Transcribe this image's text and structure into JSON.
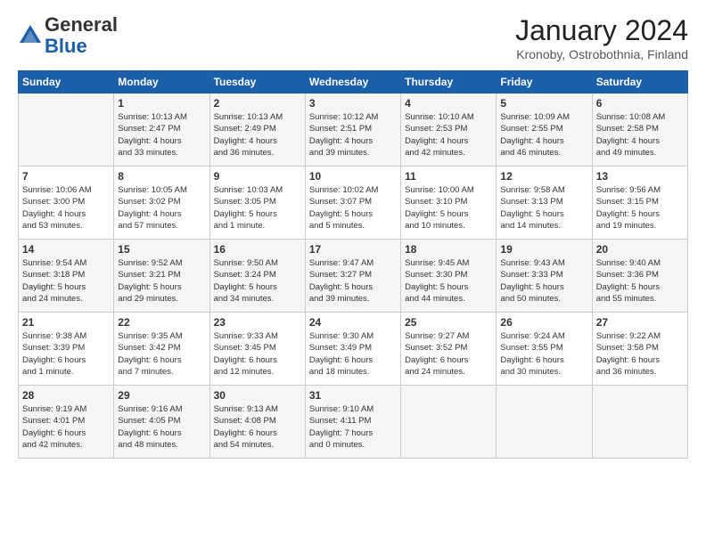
{
  "header": {
    "logo_general": "General",
    "logo_blue": "Blue",
    "month_title": "January 2024",
    "location": "Kronoby, Ostrobothnia, Finland"
  },
  "days_of_week": [
    "Sunday",
    "Monday",
    "Tuesday",
    "Wednesday",
    "Thursday",
    "Friday",
    "Saturday"
  ],
  "weeks": [
    [
      {
        "day": "",
        "info": ""
      },
      {
        "day": "1",
        "info": "Sunrise: 10:13 AM\nSunset: 2:47 PM\nDaylight: 4 hours\nand 33 minutes."
      },
      {
        "day": "2",
        "info": "Sunrise: 10:13 AM\nSunset: 2:49 PM\nDaylight: 4 hours\nand 36 minutes."
      },
      {
        "day": "3",
        "info": "Sunrise: 10:12 AM\nSunset: 2:51 PM\nDaylight: 4 hours\nand 39 minutes."
      },
      {
        "day": "4",
        "info": "Sunrise: 10:10 AM\nSunset: 2:53 PM\nDaylight: 4 hours\nand 42 minutes."
      },
      {
        "day": "5",
        "info": "Sunrise: 10:09 AM\nSunset: 2:55 PM\nDaylight: 4 hours\nand 46 minutes."
      },
      {
        "day": "6",
        "info": "Sunrise: 10:08 AM\nSunset: 2:58 PM\nDaylight: 4 hours\nand 49 minutes."
      }
    ],
    [
      {
        "day": "7",
        "info": "Sunrise: 10:06 AM\nSunset: 3:00 PM\nDaylight: 4 hours\nand 53 minutes."
      },
      {
        "day": "8",
        "info": "Sunrise: 10:05 AM\nSunset: 3:02 PM\nDaylight: 4 hours\nand 57 minutes."
      },
      {
        "day": "9",
        "info": "Sunrise: 10:03 AM\nSunset: 3:05 PM\nDaylight: 5 hours\nand 1 minute."
      },
      {
        "day": "10",
        "info": "Sunrise: 10:02 AM\nSunset: 3:07 PM\nDaylight: 5 hours\nand 5 minutes."
      },
      {
        "day": "11",
        "info": "Sunrise: 10:00 AM\nSunset: 3:10 PM\nDaylight: 5 hours\nand 10 minutes."
      },
      {
        "day": "12",
        "info": "Sunrise: 9:58 AM\nSunset: 3:13 PM\nDaylight: 5 hours\nand 14 minutes."
      },
      {
        "day": "13",
        "info": "Sunrise: 9:56 AM\nSunset: 3:15 PM\nDaylight: 5 hours\nand 19 minutes."
      }
    ],
    [
      {
        "day": "14",
        "info": "Sunrise: 9:54 AM\nSunset: 3:18 PM\nDaylight: 5 hours\nand 24 minutes."
      },
      {
        "day": "15",
        "info": "Sunrise: 9:52 AM\nSunset: 3:21 PM\nDaylight: 5 hours\nand 29 minutes."
      },
      {
        "day": "16",
        "info": "Sunrise: 9:50 AM\nSunset: 3:24 PM\nDaylight: 5 hours\nand 34 minutes."
      },
      {
        "day": "17",
        "info": "Sunrise: 9:47 AM\nSunset: 3:27 PM\nDaylight: 5 hours\nand 39 minutes."
      },
      {
        "day": "18",
        "info": "Sunrise: 9:45 AM\nSunset: 3:30 PM\nDaylight: 5 hours\nand 44 minutes."
      },
      {
        "day": "19",
        "info": "Sunrise: 9:43 AM\nSunset: 3:33 PM\nDaylight: 5 hours\nand 50 minutes."
      },
      {
        "day": "20",
        "info": "Sunrise: 9:40 AM\nSunset: 3:36 PM\nDaylight: 5 hours\nand 55 minutes."
      }
    ],
    [
      {
        "day": "21",
        "info": "Sunrise: 9:38 AM\nSunset: 3:39 PM\nDaylight: 6 hours\nand 1 minute."
      },
      {
        "day": "22",
        "info": "Sunrise: 9:35 AM\nSunset: 3:42 PM\nDaylight: 6 hours\nand 7 minutes."
      },
      {
        "day": "23",
        "info": "Sunrise: 9:33 AM\nSunset: 3:45 PM\nDaylight: 6 hours\nand 12 minutes."
      },
      {
        "day": "24",
        "info": "Sunrise: 9:30 AM\nSunset: 3:49 PM\nDaylight: 6 hours\nand 18 minutes."
      },
      {
        "day": "25",
        "info": "Sunrise: 9:27 AM\nSunset: 3:52 PM\nDaylight: 6 hours\nand 24 minutes."
      },
      {
        "day": "26",
        "info": "Sunrise: 9:24 AM\nSunset: 3:55 PM\nDaylight: 6 hours\nand 30 minutes."
      },
      {
        "day": "27",
        "info": "Sunrise: 9:22 AM\nSunset: 3:58 PM\nDaylight: 6 hours\nand 36 minutes."
      }
    ],
    [
      {
        "day": "28",
        "info": "Sunrise: 9:19 AM\nSunset: 4:01 PM\nDaylight: 6 hours\nand 42 minutes."
      },
      {
        "day": "29",
        "info": "Sunrise: 9:16 AM\nSunset: 4:05 PM\nDaylight: 6 hours\nand 48 minutes."
      },
      {
        "day": "30",
        "info": "Sunrise: 9:13 AM\nSunset: 4:08 PM\nDaylight: 6 hours\nand 54 minutes."
      },
      {
        "day": "31",
        "info": "Sunrise: 9:10 AM\nSunset: 4:11 PM\nDaylight: 7 hours\nand 0 minutes."
      },
      {
        "day": "",
        "info": ""
      },
      {
        "day": "",
        "info": ""
      },
      {
        "day": "",
        "info": ""
      }
    ]
  ]
}
